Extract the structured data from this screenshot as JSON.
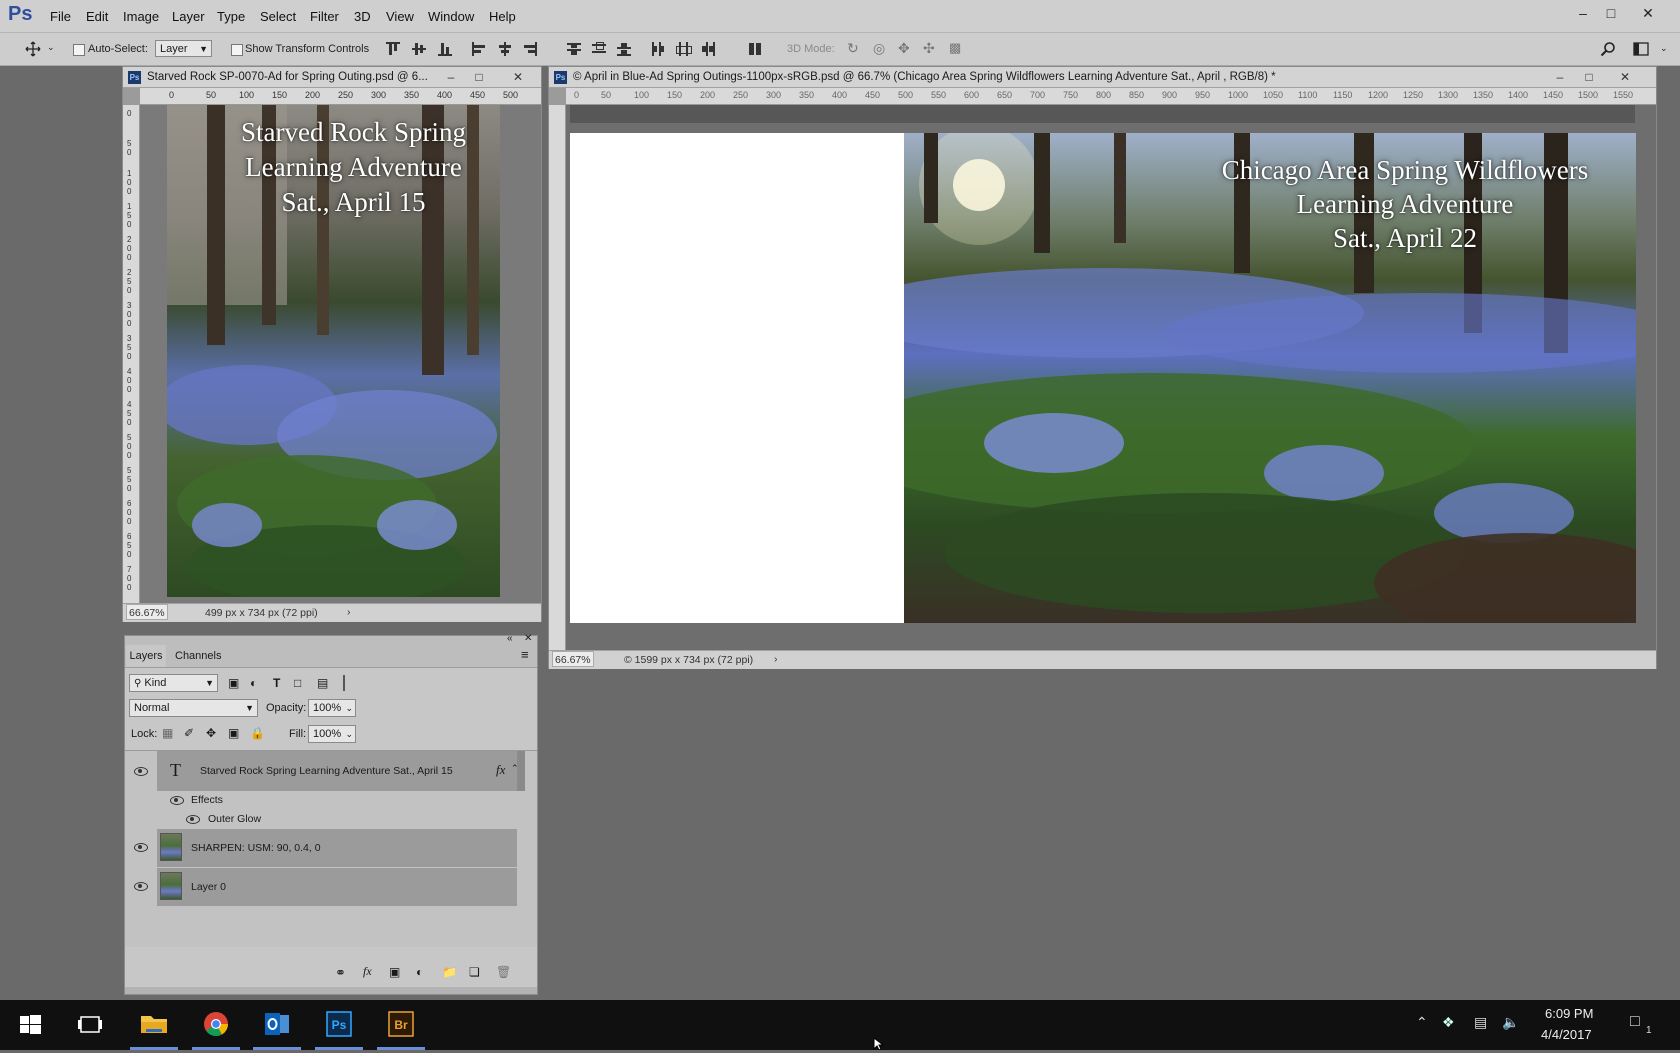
{
  "app": {
    "logo": "Ps"
  },
  "menu": [
    "File",
    "Edit",
    "Image",
    "Layer",
    "Type",
    "Select",
    "Filter",
    "3D",
    "View",
    "Window",
    "Help"
  ],
  "options": {
    "auto_select_label": "Auto-Select:",
    "auto_select_value": "Layer",
    "show_transform_label": "Show Transform Controls",
    "mode_3d_label": "3D Mode:"
  },
  "doc1": {
    "title": "Starved Rock SP-0070-Ad for Spring Outing.psd @ 6...",
    "ruler_h": [
      "0",
      "50",
      "100",
      "150",
      "200",
      "250",
      "300",
      "350",
      "400",
      "450",
      "500"
    ],
    "ruler_v": [
      "0",
      "5\n0",
      "1\n0\n0",
      "1\n5\n0",
      "2\n0\n0",
      "2\n5\n0",
      "3\n0\n0",
      "3\n5\n0",
      "4\n0\n0",
      "4\n5\n0",
      "5\n0\n0",
      "5\n5\n0",
      "6\n0\n0",
      "6\n5\n0",
      "7\n0\n0"
    ],
    "headline": [
      "Starved Rock Spring",
      "Learning Adventure",
      "Sat., April 15"
    ],
    "zoom": "66.67%",
    "dims": "499 px x 734 px (72 ppi)"
  },
  "doc2": {
    "title": "© April in Blue-Ad Spring Outings-1100px-sRGB.psd @ 66.7% (Chicago Area Spring Wildflowers Learning Adventure Sat., April , RGB/8) *",
    "ruler_h": [
      "0",
      "50",
      "100",
      "150",
      "200",
      "250",
      "300",
      "350",
      "400",
      "450",
      "500",
      "550",
      "600",
      "650",
      "700",
      "750",
      "800",
      "850",
      "900",
      "950",
      "1000",
      "1050",
      "1100",
      "1150",
      "1200",
      "1250",
      "1300",
      "1350",
      "1400",
      "1450",
      "1500",
      "1550"
    ],
    "headline": [
      "Chicago Area Spring Wildflowers",
      "Learning Adventure",
      "Sat., April 22"
    ],
    "zoom": "66.67%",
    "dims": "© 1599 px x 734 px (72 ppi)"
  },
  "layers_panel": {
    "tabs": [
      "Layers",
      "Channels"
    ],
    "filter_kind": "Kind",
    "blend_mode": "Normal",
    "opacity_label": "Opacity:",
    "opacity_value": "100%",
    "lock_label": "Lock:",
    "fill_label": "Fill:",
    "fill_value": "100%",
    "layers": [
      {
        "name": "Starved Rock Spring Learning Adventure Sat., April 15",
        "kind": "text",
        "fx": "fx"
      },
      {
        "name": "Effects",
        "kind": "effects"
      },
      {
        "name": "Outer Glow",
        "kind": "effect"
      },
      {
        "name": "SHARPEN: USM: 90, 0.4, 0",
        "kind": "image"
      },
      {
        "name": "Layer 0",
        "kind": "image"
      }
    ]
  },
  "taskbar": {
    "time": "6:09 PM",
    "date": "4/4/2017",
    "notification_count": "1",
    "app_icons": [
      "start-icon",
      "task-view-icon",
      "file-explorer-icon",
      "chrome-icon",
      "outlook-icon",
      "photoshop-icon",
      "bridge-icon"
    ]
  },
  "colors": {
    "accent": "#2f4f9e",
    "panel": "#c7c7c7",
    "workspace": "#6a6a6a"
  }
}
